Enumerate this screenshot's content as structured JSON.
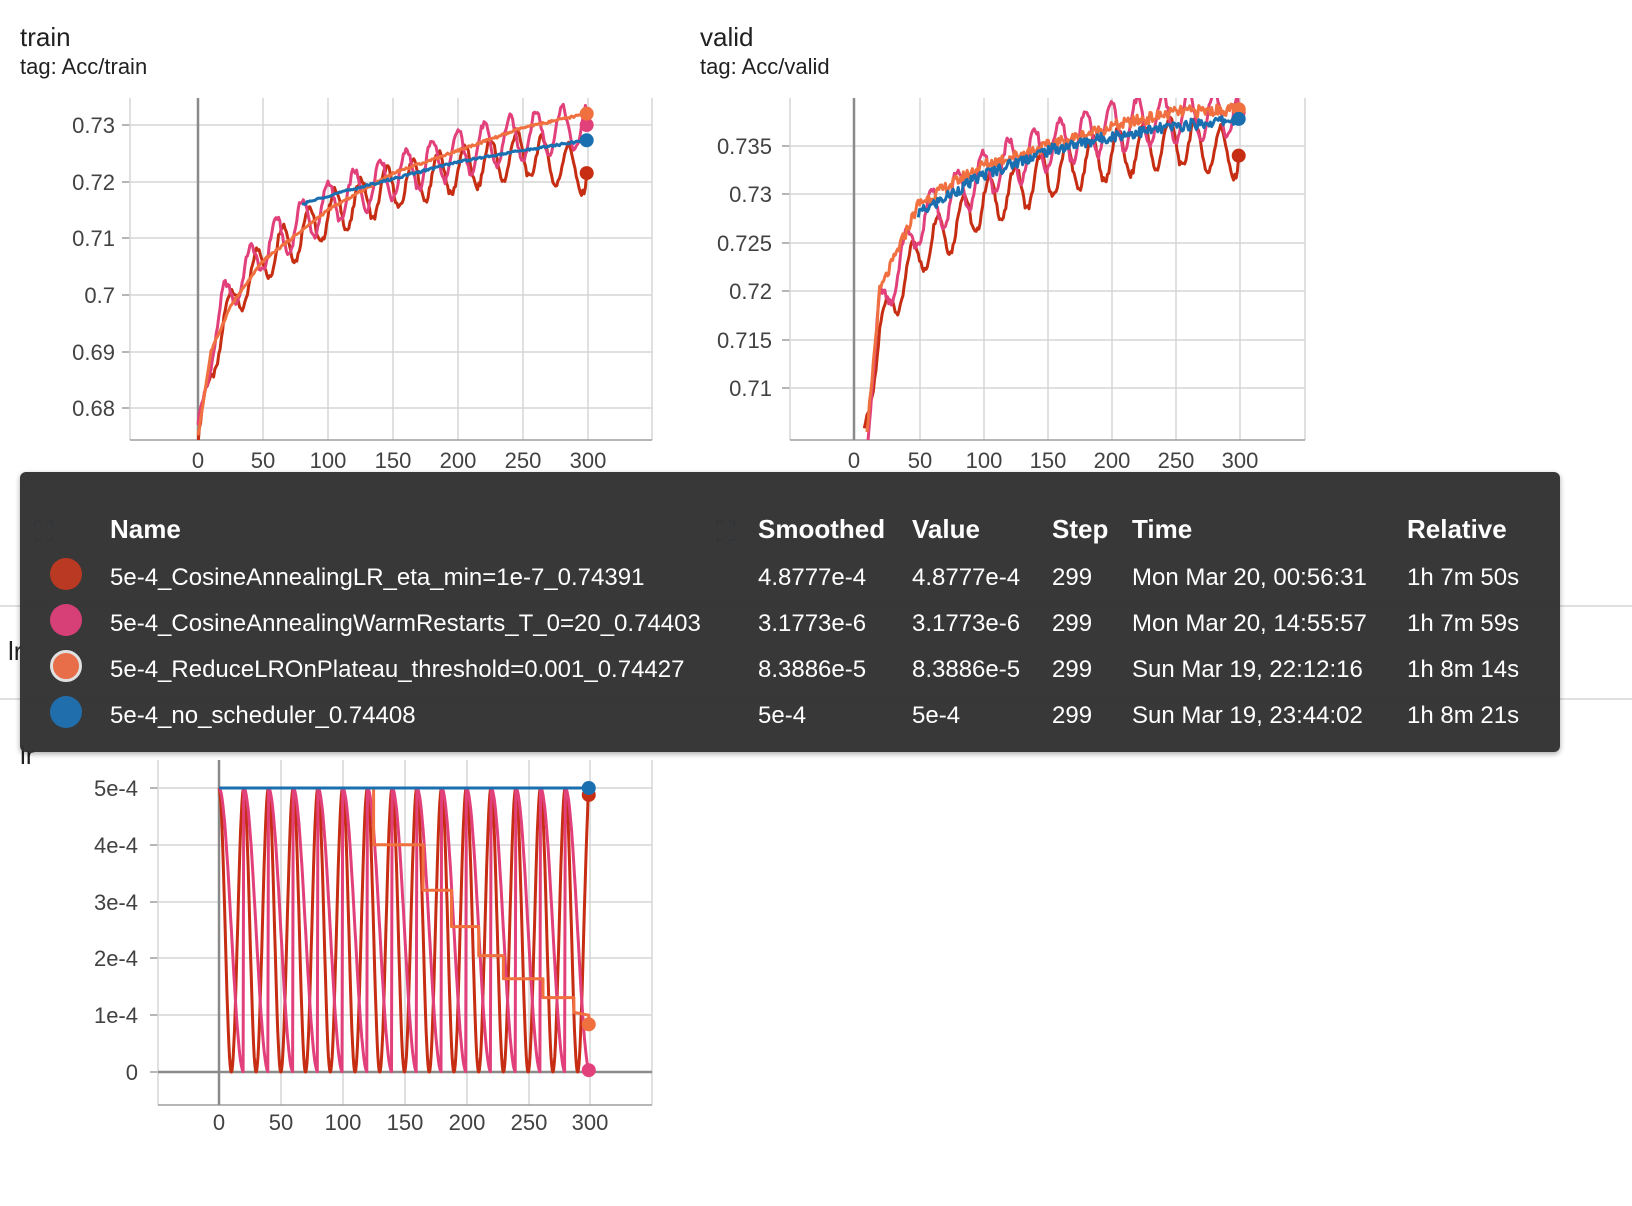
{
  "cards": [
    {
      "title": "train",
      "tag": "tag: Acc/train"
    },
    {
      "title": "valid",
      "tag": "tag: Acc/valid"
    }
  ],
  "lr_section": {
    "label": "lr",
    "title": "lr"
  },
  "colors": {
    "cosine": "#c62d12",
    "warm": "#e2407a",
    "plateau": "#f0703f",
    "none": "#1a6fb0"
  },
  "tooltip": {
    "headers": {
      "name": "Name",
      "smoothed": "Smoothed",
      "value": "Value",
      "step": "Step",
      "time": "Time",
      "relative": "Relative"
    },
    "rows": [
      {
        "name": "5e-4_CosineAnnealingLR_eta_min=1e-7_0.74391",
        "smoothed": "4.8777e-4",
        "value": "4.8777e-4",
        "step": "299",
        "time": "Mon Mar 20, 00:56:31",
        "relative": "1h 7m 50s",
        "color": "#b8331c"
      },
      {
        "name": "5e-4_CosineAnnealingWarmRestarts_T_0=20_0.74403",
        "smoothed": "3.1773e-6",
        "value": "3.1773e-6",
        "step": "299",
        "time": "Mon Mar 20, 14:55:57",
        "relative": "1h 7m 59s",
        "color": "#d63a72"
      },
      {
        "name": "5e-4_ReduceLROnPlateau_threshold=0.001_0.74427",
        "smoothed": "8.3886e-5",
        "value": "8.3886e-5",
        "step": "299",
        "time": "Sun Mar 19, 22:12:16",
        "relative": "1h 8m 14s",
        "color": "#e86a45"
      },
      {
        "name": "5e-4_no_scheduler_0.74408",
        "smoothed": "5e-4",
        "value": "5e-4",
        "step": "299",
        "time": "Sun Mar 19, 23:44:02",
        "relative": "1h 8m 21s",
        "color": "#1a6aaa"
      }
    ]
  },
  "chart_data": [
    {
      "type": "line",
      "title": "train",
      "subtitle": "tag: Acc/train",
      "xlim": [
        -50,
        350
      ],
      "ylim": [
        0.675,
        0.7325
      ],
      "xticks": [
        "0",
        "50",
        "100",
        "150",
        "200",
        "250",
        "300"
      ],
      "yticks": [
        "0.68",
        "0.69",
        "0.7",
        "0.71",
        "0.72",
        "0.73"
      ],
      "series": [
        {
          "name": "5e-4_CosineAnnealingLR_eta_min=1e-7_0.74391",
          "color": "#c62d12",
          "pattern": "oscillating",
          "period": 20,
          "amplitude": 0.004,
          "points": [
            [
              0,
              0.674
            ],
            [
              5,
              0.68
            ],
            [
              20,
              0.696
            ],
            [
              50,
              0.706
            ],
            [
              100,
              0.714
            ],
            [
              150,
              0.719
            ],
            [
              200,
              0.722
            ],
            [
              250,
              0.725
            ],
            [
              299,
              0.7215
            ]
          ]
        },
        {
          "name": "5e-4_CosineAnnealingWarmRestarts_T_0=20_0.74403",
          "color": "#e2407a",
          "pattern": "oscillating",
          "period": 20,
          "amplitude": 0.004,
          "points": [
            [
              0,
              0.675
            ],
            [
              10,
              0.69
            ],
            [
              20,
              0.699
            ],
            [
              50,
              0.708
            ],
            [
              100,
              0.716
            ],
            [
              150,
              0.721
            ],
            [
              200,
              0.725
            ],
            [
              250,
              0.728
            ],
            [
              299,
              0.73
            ]
          ]
        },
        {
          "name": "5e-4_ReduceLROnPlateau_threshold=0.001_0.74427",
          "color": "#f0703f",
          "pattern": "smooth",
          "points": [
            [
              0,
              0.675
            ],
            [
              10,
              0.69
            ],
            [
              25,
              0.698
            ],
            [
              50,
              0.706
            ],
            [
              100,
              0.715
            ],
            [
              150,
              0.7215
            ],
            [
              200,
              0.7255
            ],
            [
              250,
              0.7295
            ],
            [
              299,
              0.732
            ]
          ]
        },
        {
          "name": "5e-4_no_scheduler_0.74408",
          "color": "#1a6fb0",
          "pattern": "smooth",
          "points": [
            [
              80,
              0.716
            ],
            [
              100,
              0.7175
            ],
            [
              150,
              0.7205
            ],
            [
              200,
              0.7235
            ],
            [
              250,
              0.7255
            ],
            [
              299,
              0.7273
            ]
          ]
        }
      ]
    },
    {
      "type": "line",
      "title": "valid",
      "subtitle": "tag: Acc/valid",
      "xlim": [
        -50,
        350
      ],
      "ylim": [
        0.705,
        0.7395
      ],
      "xticks": [
        "0",
        "50",
        "100",
        "150",
        "200",
        "250",
        "300"
      ],
      "yticks": [
        "0.71",
        "0.715",
        "0.72",
        "0.725",
        "0.73",
        "0.735"
      ],
      "series": [
        {
          "name": "5e-4_CosineAnnealingLR_eta_min=1e-7_0.74391",
          "color": "#c62d12",
          "pattern": "oscillating",
          "period": 20,
          "amplitude": 0.0025,
          "points": [
            [
              8,
              0.705
            ],
            [
              20,
              0.716
            ],
            [
              50,
              0.724
            ],
            [
              100,
              0.729
            ],
            [
              150,
              0.732
            ],
            [
              200,
              0.734
            ],
            [
              250,
              0.7355
            ],
            [
              299,
              0.734
            ]
          ]
        },
        {
          "name": "5e-4_CosineAnnealingWarmRestarts_T_0=20_0.74403",
          "color": "#e2407a",
          "pattern": "oscillating",
          "period": 20,
          "amplitude": 0.0025,
          "points": [
            [
              10,
              0.705
            ],
            [
              20,
              0.718
            ],
            [
              50,
              0.727
            ],
            [
              100,
              0.732
            ],
            [
              150,
              0.735
            ],
            [
              200,
              0.737
            ],
            [
              250,
              0.738
            ],
            [
              299,
              0.7385
            ]
          ]
        },
        {
          "name": "5e-4_ReduceLROnPlateau_threshold=0.001_0.74427",
          "color": "#f0703f",
          "pattern": "noisy",
          "points": [
            [
              10,
              0.705
            ],
            [
              20,
              0.72
            ],
            [
              50,
              0.729
            ],
            [
              100,
              0.733
            ],
            [
              150,
              0.735
            ],
            [
              200,
              0.737
            ],
            [
              250,
              0.7385
            ],
            [
              299,
              0.7388
            ]
          ]
        },
        {
          "name": "5e-4_no_scheduler_0.74408",
          "color": "#1a6fb0",
          "pattern": "noisy",
          "points": [
            [
              50,
              0.728
            ],
            [
              100,
              0.732
            ],
            [
              150,
              0.7345
            ],
            [
              200,
              0.736
            ],
            [
              250,
              0.737
            ],
            [
              299,
              0.7378
            ]
          ]
        }
      ]
    },
    {
      "type": "line",
      "title": "lr",
      "xlim": [
        -50,
        350
      ],
      "ylim": [
        -5e-05,
        0.00053
      ],
      "xticks": [
        "0",
        "50",
        "100",
        "150",
        "200",
        "250",
        "300"
      ],
      "yticks": [
        "0",
        "1e-4",
        "2e-4",
        "3e-4",
        "4e-4",
        "5e-4"
      ],
      "series": [
        {
          "name": "5e-4_CosineAnnealingLR_eta_min=1e-7_0.74391",
          "color": "#c62d12",
          "pattern": "cosine",
          "period": 20,
          "points": [
            [
              0,
              0.0005
            ],
            [
              10,
              0
            ],
            [
              20,
              0.0005
            ],
            [
              299,
              0.00048777
            ]
          ]
        },
        {
          "name": "5e-4_CosineAnnealingWarmRestarts_T_0=20_0.74403",
          "color": "#e2407a",
          "pattern": "sawtooth",
          "period": 20,
          "points": [
            [
              0,
              0.0005
            ],
            [
              19,
              0
            ],
            [
              20,
              0.0005
            ],
            [
              299,
              3.1773e-06
            ]
          ]
        },
        {
          "name": "5e-4_ReduceLROnPlateau_threshold=0.001_0.74427",
          "color": "#f0703f",
          "pattern": "step",
          "points": [
            [
              0,
              0.0005
            ],
            [
              125,
              0.0005
            ],
            [
              125,
              0.0004
            ],
            [
              165,
              0.0004
            ],
            [
              165,
              0.00032
            ],
            [
              188,
              0.00032
            ],
            [
              188,
              0.000256
            ],
            [
              210,
              0.000256
            ],
            [
              210,
              0.000205
            ],
            [
              230,
              0.000205
            ],
            [
              230,
              0.000164
            ],
            [
              262,
              0.000164
            ],
            [
              262,
              0.000131
            ],
            [
              287,
              0.000131
            ],
            [
              287,
              0.000105
            ],
            [
              299,
              0.0001
            ],
            [
              299,
              8.3886e-05
            ]
          ]
        },
        {
          "name": "5e-4_no_scheduler_0.74408",
          "color": "#1a6fb0",
          "pattern": "constant",
          "points": [
            [
              0,
              0.0005
            ],
            [
              299,
              0.0005
            ]
          ]
        }
      ]
    }
  ]
}
